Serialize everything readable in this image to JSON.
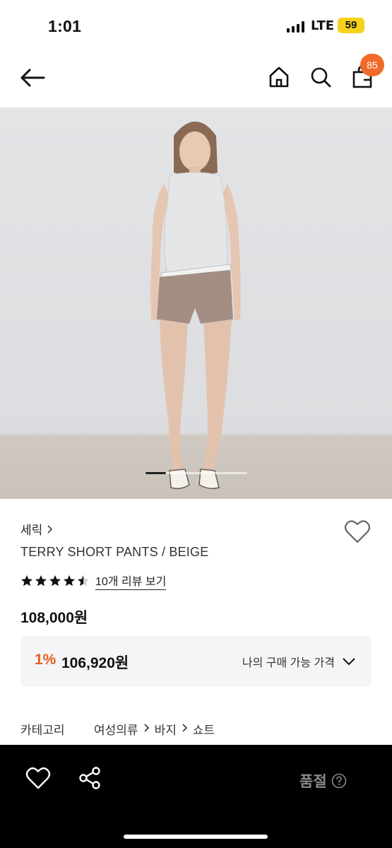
{
  "status_bar": {
    "time": "1:01",
    "network": "LTE",
    "battery": "59"
  },
  "nav": {
    "icons": [
      "back-arrow-icon",
      "home-icon",
      "search-icon",
      "shopping-bag-icon"
    ],
    "cart_count": "85"
  },
  "gallery": {
    "image": "model-photo",
    "slide_progress": 0.2
  },
  "product": {
    "brand": "세릭",
    "name": "TERRY SHORT PANTS / BEIGE",
    "rating": 4.5,
    "review_link": "10개 리뷰 보기",
    "price": "108,000원",
    "discount": {
      "percent": "1%",
      "price": "106,920원",
      "cta": "나의 구매 가능 가격"
    },
    "category": {
      "label": "카테고리",
      "path": [
        "여성의류",
        "바지",
        "쇼트"
      ]
    }
  },
  "bottom_bar": {
    "icons": [
      "heart-icon",
      "share-icon"
    ],
    "status": "품절"
  },
  "colors": {
    "accent": "#ea5b1d",
    "badge": "#f06a2a",
    "bottom_bar_bg": "#000000",
    "soldout_text": "#8a8a8a"
  }
}
